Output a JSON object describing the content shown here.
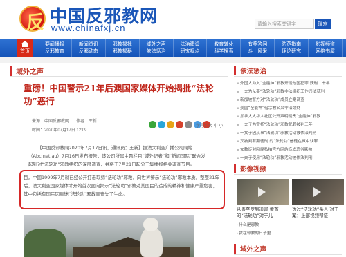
{
  "header": {
    "site_title": "中国反邪教网",
    "site_url": "www.chinafxj.cn",
    "logo_glyph": "反",
    "search_placeholder": "请输入搜索关键字",
    "search_button": "搜索"
  },
  "nav": {
    "home_label": "首页",
    "items": [
      {
        "label": "要闻播报\n反邪教育"
      },
      {
        "label": "新闻资讯\n反邪动态"
      },
      {
        "label": "邪教揭批\n邪教揭秘"
      },
      {
        "label": "域外之声\n依法惩治"
      },
      {
        "label": "法治建设\n研究视点"
      },
      {
        "label": "教育转化\n科学探索"
      },
      {
        "label": "有奖答问\n斗士风采"
      },
      {
        "label": "防范指南\n理论研究"
      },
      {
        "label": "影视频道\n网络书屋"
      }
    ]
  },
  "main": {
    "section_title": "域外之声",
    "article_title": "重磅！中国警示21年后澳国家媒体开始揭批“法轮功”恶行",
    "meta_source": "来源：中国反邪教网",
    "meta_author": "作者：王新",
    "meta_time": "时间：2020年07月17日 12:09",
    "zoom_label": "字号：大 中 小",
    "paragraph_1": "【中国反邪教网2020年7月17日讯，通讯员：王新】据澳大利亚广播公司网站（Abc.net.au）7月16日发布报告，该公司所属主题栏目“域外记者”和“新闻国际”联合发起针对“法轮功”邪教组织的深度调查，并将于7月21日起分三集播报相关调查节目。",
    "paragraph_2": "目。中国1999年7月就已经公开打击取缔“法轮功”邪教，向世界警示“法轮功”邪教本质。整整21年后，澳大利亚国家媒体才开始首次面向揭示“法轮功”邪教对其国民的造成的精神和健康严重危害，其中包括有国民因痴迷“法轮功”邪教而丧失了生命。"
  },
  "share_colors": [
    "#3aa63a",
    "#2aa6d8",
    "#e8a317",
    "#d6412b",
    "#8a8a8a",
    "#4a9be0",
    "#d03d2d"
  ],
  "sidebar": {
    "section1_title": "依法惩治",
    "list1": [
      "外国人为入“全能神”邪教开设他国犯罪 获刑二十年",
      "一夫为从事“法轮功”邪教非法组织工作违法获刑",
      "新加坡警方对“法轮功”成员立案调查",
      "美国“全能神”借宗教名义非法敛财",
      "加拿大大华人社区公开声明谴责“全能神”邪教",
      "一夫子为宣扬“法轮功”邪教犯罪被判三年",
      "一女子因从事“法轮功”邪教活动被依法判刑",
      "又被判有期徒刑 的“法轮功”信徒在狱中认罪",
      "女教徒对网民私拍官方网站造成恶劣影响",
      "一夫子使用“法轮功”邪教活动被依法判刑"
    ],
    "section2_title": "影像视频",
    "videos": [
      {
        "caption": "从善至罗到迫害 黄首的“法轮功”对于儿"
      },
      {
        "caption": "透过“法轮功”杀人 对于案：上部视频帮证"
      }
    ],
    "list2": [
      "什么是邪教",
      "我在邪教的日子里"
    ],
    "section3_title": "域外之声"
  }
}
